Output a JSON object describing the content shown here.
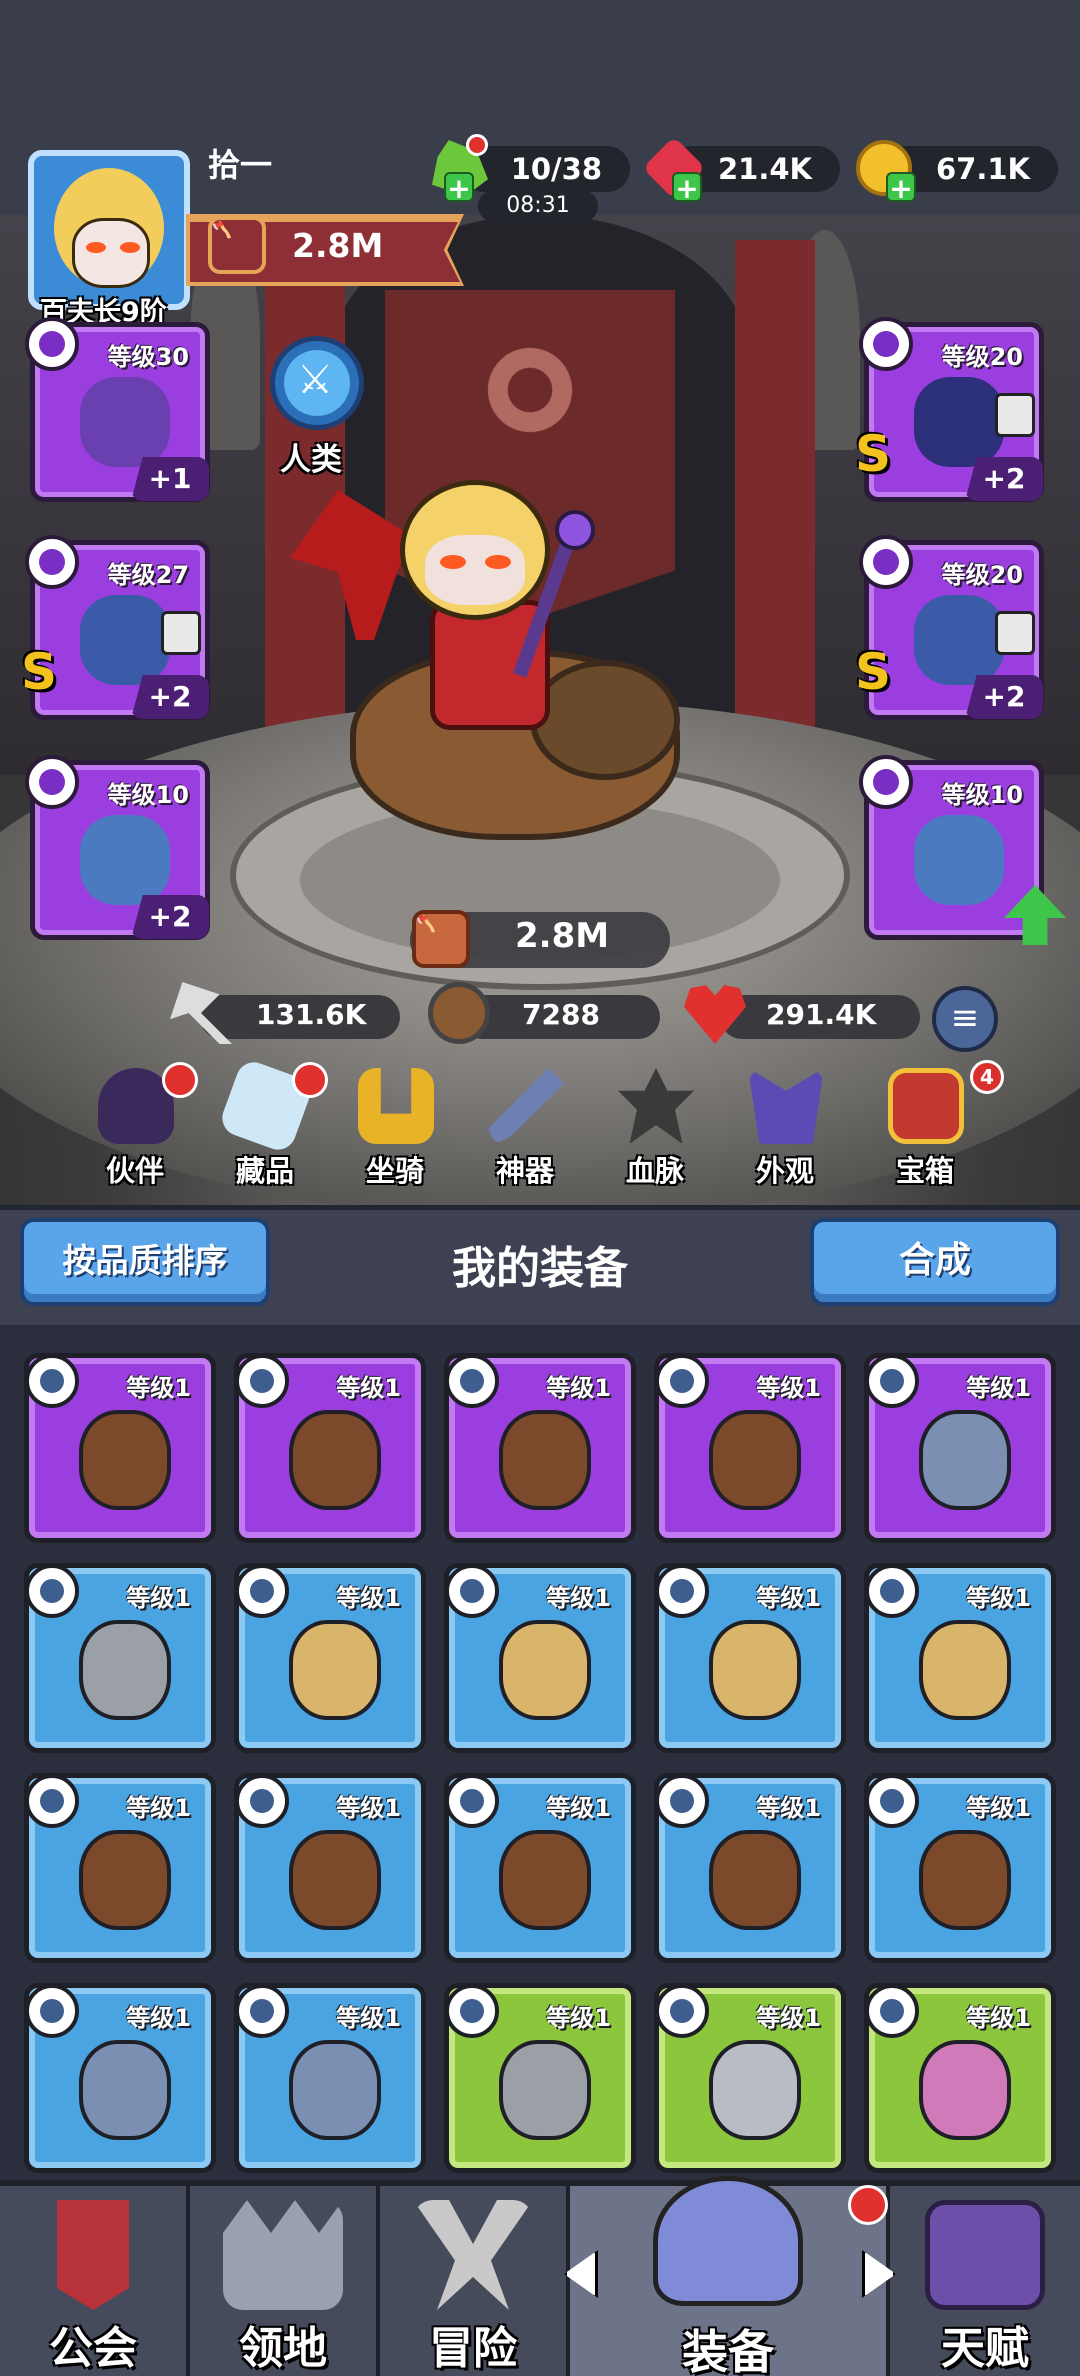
{
  "player": {
    "name": "拾一",
    "rank": "百夫长9阶",
    "power": "2.8M",
    "race": "人类"
  },
  "resources": {
    "energy": "10/38",
    "energy_timer": "08:31",
    "gems": "21.4K",
    "gold": "67.1K"
  },
  "equipped": {
    "left": [
      {
        "level": "等级30",
        "plus": "+1"
      },
      {
        "level": "等级27",
        "plus": "+2",
        "grade": "S"
      },
      {
        "level": "等级10",
        "plus": "+2"
      }
    ],
    "right": [
      {
        "level": "等级20",
        "plus": "+2",
        "grade": "S"
      },
      {
        "level": "等级20",
        "plus": "+2",
        "grade": "S"
      },
      {
        "level": "等级10"
      }
    ]
  },
  "stats": {
    "combat_power": "2.8M",
    "attack": "131.6K",
    "defense": "7288",
    "hp": "291.4K"
  },
  "features": [
    {
      "label": "伙伴"
    },
    {
      "label": "藏品"
    },
    {
      "label": "坐骑"
    },
    {
      "label": "神器"
    },
    {
      "label": "血脉"
    },
    {
      "label": "外观"
    },
    {
      "label": "宝箱",
      "badge": "4"
    }
  ],
  "equipment": {
    "sort_label": "按品质排序",
    "title": "我的装备",
    "combine_label": "合成",
    "items": [
      {
        "level": "等级1",
        "quality": "purple",
        "icon": "ring-icon"
      },
      {
        "level": "等级1",
        "quality": "purple",
        "icon": "ring-icon"
      },
      {
        "level": "等级1",
        "quality": "purple",
        "icon": "ring-icon"
      },
      {
        "level": "等级1",
        "quality": "purple",
        "icon": "ring-icon"
      },
      {
        "level": "等级1",
        "quality": "purple",
        "icon": "necklace-icon"
      },
      {
        "level": "等级1",
        "quality": "blue",
        "icon": "axe-icon"
      },
      {
        "level": "等级1",
        "quality": "blue",
        "icon": "armor-icon"
      },
      {
        "level": "等级1",
        "quality": "blue",
        "icon": "armor-icon"
      },
      {
        "level": "等级1",
        "quality": "blue",
        "icon": "armor-icon"
      },
      {
        "level": "等级1",
        "quality": "blue",
        "icon": "armor-icon"
      },
      {
        "level": "等级1",
        "quality": "blue",
        "icon": "ring-icon"
      },
      {
        "level": "等级1",
        "quality": "blue",
        "icon": "ring-icon"
      },
      {
        "level": "等级1",
        "quality": "blue",
        "icon": "ring-icon"
      },
      {
        "level": "等级1",
        "quality": "blue",
        "icon": "ring-icon"
      },
      {
        "level": "等级1",
        "quality": "blue",
        "icon": "ring-icon"
      },
      {
        "level": "等级1",
        "quality": "blue",
        "icon": "necklace-icon"
      },
      {
        "level": "等级1",
        "quality": "blue",
        "icon": "necklace-icon"
      },
      {
        "level": "等级1",
        "quality": "green",
        "icon": "axe-icon"
      },
      {
        "level": "等级1",
        "quality": "green",
        "icon": "hammer-icon"
      },
      {
        "level": "等级1",
        "quality": "green",
        "icon": "bow-icon"
      }
    ]
  },
  "nav": {
    "guild": "公会",
    "territory": "领地",
    "adventure": "冒险",
    "equipment": "装备",
    "talent": "天赋"
  }
}
